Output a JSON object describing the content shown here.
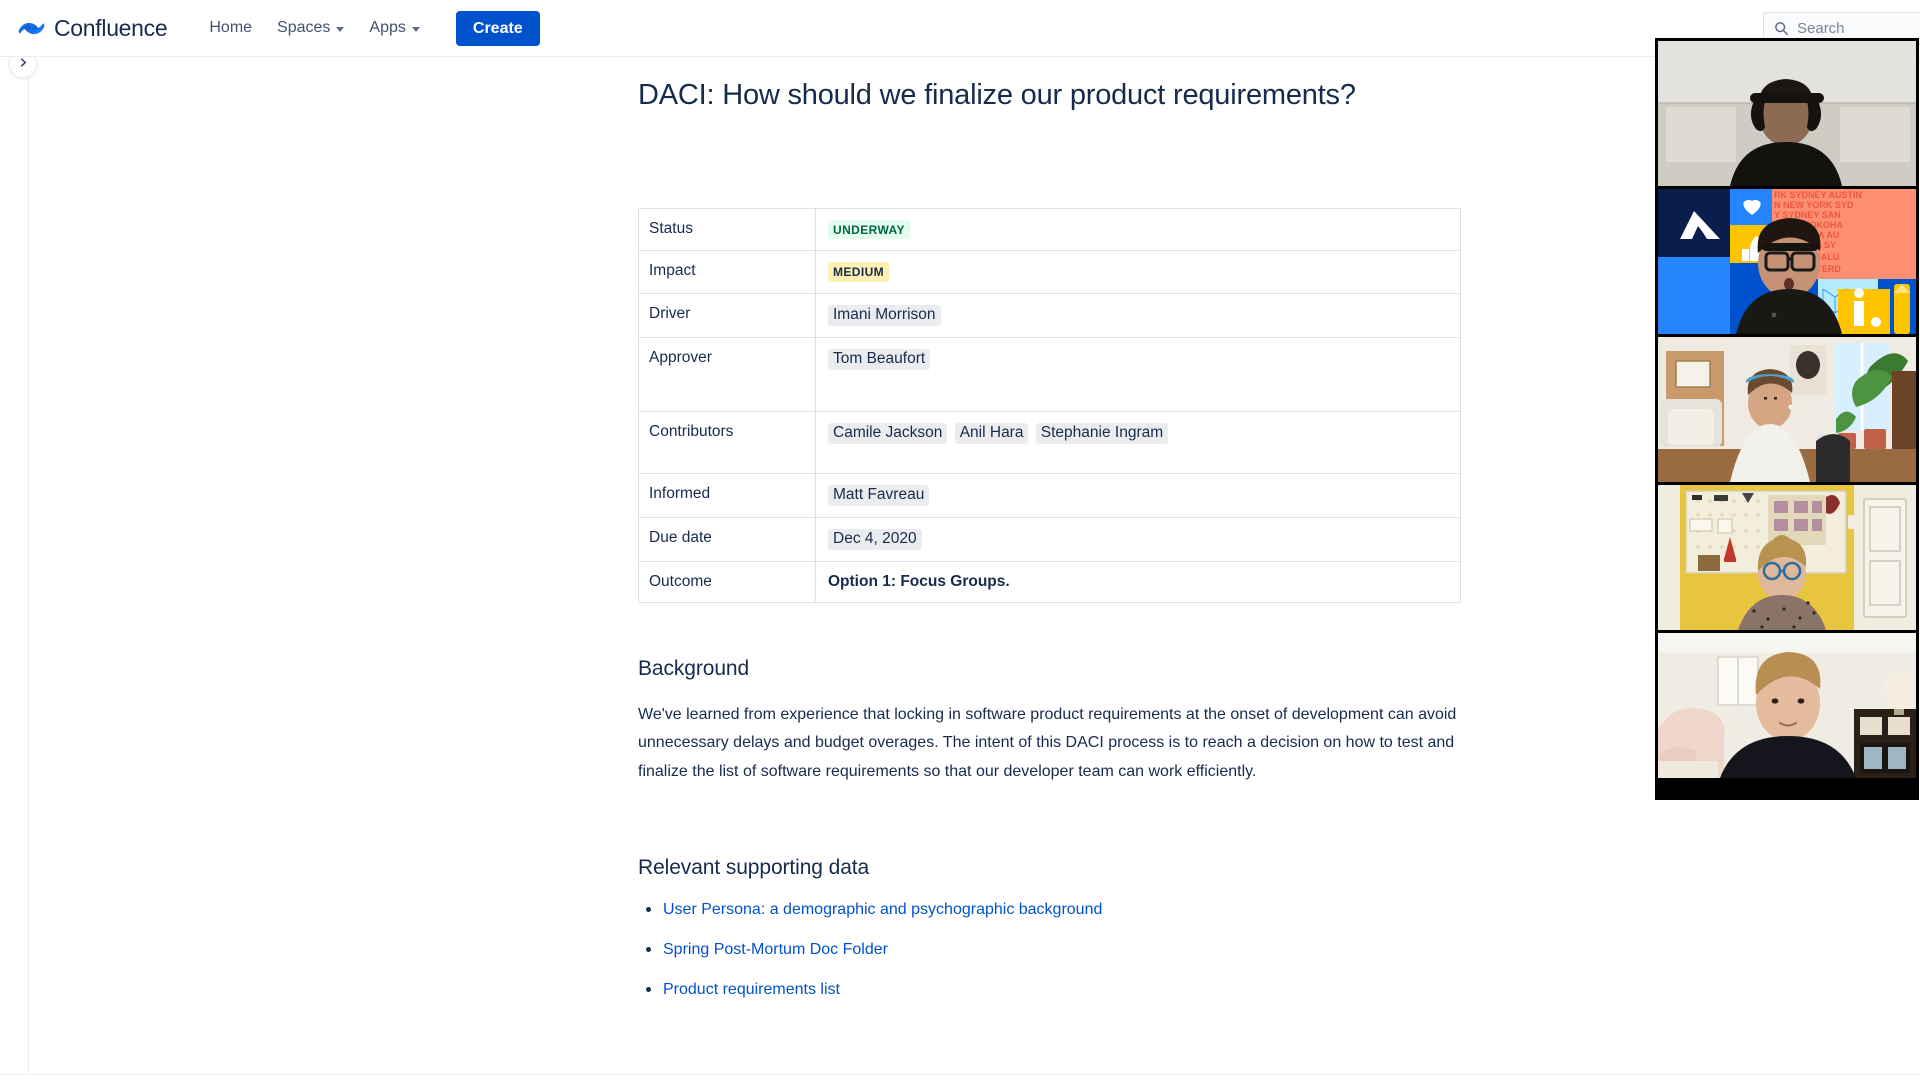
{
  "app": {
    "brand_name": "Confluence",
    "logo_icon": "confluence-logo-icon"
  },
  "topnav": {
    "items": [
      {
        "label": "Home",
        "has_chevron": false
      },
      {
        "label": "Spaces",
        "has_chevron": true
      },
      {
        "label": "Apps",
        "has_chevron": true
      }
    ],
    "create_label": "Create",
    "create_color": "#0052CC"
  },
  "search": {
    "placeholder": "Search",
    "value": "",
    "icon": "search-icon"
  },
  "sidebar": {
    "expand_icon": "chevron-right-icon",
    "collapsed": true
  },
  "page": {
    "title": "DACI: How should we finalize our product requirements?"
  },
  "daci_table": {
    "rows": [
      {
        "label": "Status",
        "kind": "lozenge-green",
        "value": "UNDERWAY"
      },
      {
        "label": "Impact",
        "kind": "lozenge-yellow",
        "value": "MEDIUM"
      },
      {
        "label": "Driver",
        "kind": "mentions",
        "mentions": [
          "Imani Morrison"
        ]
      },
      {
        "label": "Approver",
        "kind": "mentions",
        "mentions": [
          "Tom Beaufort"
        ]
      },
      {
        "label": "Contributors",
        "kind": "mentions",
        "mentions": [
          "Camile Jackson",
          "Anil Hara",
          "Stephanie Ingram"
        ]
      },
      {
        "label": "Informed",
        "kind": "mentions",
        "mentions": [
          "Matt Favreau"
        ]
      },
      {
        "label": "Due date",
        "kind": "date",
        "value": "Dec 4, 2020"
      },
      {
        "label": "Outcome",
        "kind": "bold",
        "value": "Option 1: Focus Groups."
      }
    ]
  },
  "sections": {
    "background": {
      "heading": "Background",
      "paragraph": "We've learned from experience that locking in software product requirements at the onset of development can avoid unnecessary delays and budget overages. The intent of this DACI process is to reach a decision on how to test and finalize the list of software requirements so that our developer team can work efficiently."
    },
    "supporting": {
      "heading": "Relevant supporting data",
      "links": [
        "User Persona: a demographic and psychographic background",
        "Spring Post-Mortum Doc Folder",
        "Product requirements list"
      ],
      "link_color": "#0052CC"
    }
  },
  "video_call": {
    "participant_count": 5,
    "tiles": [
      {
        "name": "participant-tile-1",
        "description": "person wearing over-ear headphones, white panelled wall"
      },
      {
        "name": "participant-tile-2",
        "description": "person with glasses and headset, Atlassian branded virtual background"
      },
      {
        "name": "participant-tile-3",
        "description": "person with blue headband in living room with plants"
      },
      {
        "name": "participant-tile-4",
        "description": "person with blue glasses, yellow wall with pegboard"
      },
      {
        "name": "participant-tile-5",
        "description": "person in dark shirt, bedroom with pillows and lamp"
      }
    ]
  }
}
